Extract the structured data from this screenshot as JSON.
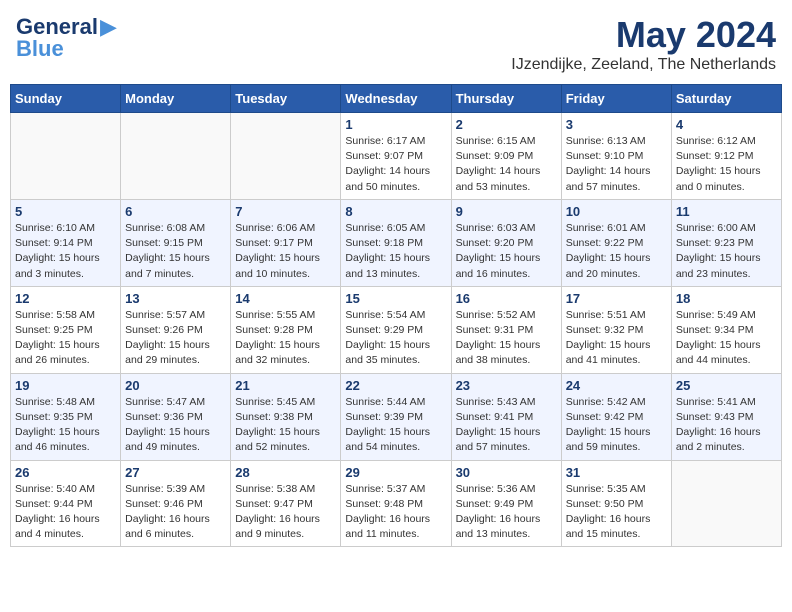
{
  "header": {
    "logo_general": "General",
    "logo_blue": "Blue",
    "month": "May 2024",
    "location": "IJzendijke, Zeeland, The Netherlands"
  },
  "days_of_week": [
    "Sunday",
    "Monday",
    "Tuesday",
    "Wednesday",
    "Thursday",
    "Friday",
    "Saturday"
  ],
  "weeks": [
    {
      "days": [
        {
          "number": "",
          "info": ""
        },
        {
          "number": "",
          "info": ""
        },
        {
          "number": "",
          "info": ""
        },
        {
          "number": "1",
          "info": "Sunrise: 6:17 AM\nSunset: 9:07 PM\nDaylight: 14 hours\nand 50 minutes."
        },
        {
          "number": "2",
          "info": "Sunrise: 6:15 AM\nSunset: 9:09 PM\nDaylight: 14 hours\nand 53 minutes."
        },
        {
          "number": "3",
          "info": "Sunrise: 6:13 AM\nSunset: 9:10 PM\nDaylight: 14 hours\nand 57 minutes."
        },
        {
          "number": "4",
          "info": "Sunrise: 6:12 AM\nSunset: 9:12 PM\nDaylight: 15 hours\nand 0 minutes."
        }
      ]
    },
    {
      "days": [
        {
          "number": "5",
          "info": "Sunrise: 6:10 AM\nSunset: 9:14 PM\nDaylight: 15 hours\nand 3 minutes."
        },
        {
          "number": "6",
          "info": "Sunrise: 6:08 AM\nSunset: 9:15 PM\nDaylight: 15 hours\nand 7 minutes."
        },
        {
          "number": "7",
          "info": "Sunrise: 6:06 AM\nSunset: 9:17 PM\nDaylight: 15 hours\nand 10 minutes."
        },
        {
          "number": "8",
          "info": "Sunrise: 6:05 AM\nSunset: 9:18 PM\nDaylight: 15 hours\nand 13 minutes."
        },
        {
          "number": "9",
          "info": "Sunrise: 6:03 AM\nSunset: 9:20 PM\nDaylight: 15 hours\nand 16 minutes."
        },
        {
          "number": "10",
          "info": "Sunrise: 6:01 AM\nSunset: 9:22 PM\nDaylight: 15 hours\nand 20 minutes."
        },
        {
          "number": "11",
          "info": "Sunrise: 6:00 AM\nSunset: 9:23 PM\nDaylight: 15 hours\nand 23 minutes."
        }
      ]
    },
    {
      "days": [
        {
          "number": "12",
          "info": "Sunrise: 5:58 AM\nSunset: 9:25 PM\nDaylight: 15 hours\nand 26 minutes."
        },
        {
          "number": "13",
          "info": "Sunrise: 5:57 AM\nSunset: 9:26 PM\nDaylight: 15 hours\nand 29 minutes."
        },
        {
          "number": "14",
          "info": "Sunrise: 5:55 AM\nSunset: 9:28 PM\nDaylight: 15 hours\nand 32 minutes."
        },
        {
          "number": "15",
          "info": "Sunrise: 5:54 AM\nSunset: 9:29 PM\nDaylight: 15 hours\nand 35 minutes."
        },
        {
          "number": "16",
          "info": "Sunrise: 5:52 AM\nSunset: 9:31 PM\nDaylight: 15 hours\nand 38 minutes."
        },
        {
          "number": "17",
          "info": "Sunrise: 5:51 AM\nSunset: 9:32 PM\nDaylight: 15 hours\nand 41 minutes."
        },
        {
          "number": "18",
          "info": "Sunrise: 5:49 AM\nSunset: 9:34 PM\nDaylight: 15 hours\nand 44 minutes."
        }
      ]
    },
    {
      "days": [
        {
          "number": "19",
          "info": "Sunrise: 5:48 AM\nSunset: 9:35 PM\nDaylight: 15 hours\nand 46 minutes."
        },
        {
          "number": "20",
          "info": "Sunrise: 5:47 AM\nSunset: 9:36 PM\nDaylight: 15 hours\nand 49 minutes."
        },
        {
          "number": "21",
          "info": "Sunrise: 5:45 AM\nSunset: 9:38 PM\nDaylight: 15 hours\nand 52 minutes."
        },
        {
          "number": "22",
          "info": "Sunrise: 5:44 AM\nSunset: 9:39 PM\nDaylight: 15 hours\nand 54 minutes."
        },
        {
          "number": "23",
          "info": "Sunrise: 5:43 AM\nSunset: 9:41 PM\nDaylight: 15 hours\nand 57 minutes."
        },
        {
          "number": "24",
          "info": "Sunrise: 5:42 AM\nSunset: 9:42 PM\nDaylight: 15 hours\nand 59 minutes."
        },
        {
          "number": "25",
          "info": "Sunrise: 5:41 AM\nSunset: 9:43 PM\nDaylight: 16 hours\nand 2 minutes."
        }
      ]
    },
    {
      "days": [
        {
          "number": "26",
          "info": "Sunrise: 5:40 AM\nSunset: 9:44 PM\nDaylight: 16 hours\nand 4 minutes."
        },
        {
          "number": "27",
          "info": "Sunrise: 5:39 AM\nSunset: 9:46 PM\nDaylight: 16 hours\nand 6 minutes."
        },
        {
          "number": "28",
          "info": "Sunrise: 5:38 AM\nSunset: 9:47 PM\nDaylight: 16 hours\nand 9 minutes."
        },
        {
          "number": "29",
          "info": "Sunrise: 5:37 AM\nSunset: 9:48 PM\nDaylight: 16 hours\nand 11 minutes."
        },
        {
          "number": "30",
          "info": "Sunrise: 5:36 AM\nSunset: 9:49 PM\nDaylight: 16 hours\nand 13 minutes."
        },
        {
          "number": "31",
          "info": "Sunrise: 5:35 AM\nSunset: 9:50 PM\nDaylight: 16 hours\nand 15 minutes."
        },
        {
          "number": "",
          "info": ""
        }
      ]
    }
  ]
}
